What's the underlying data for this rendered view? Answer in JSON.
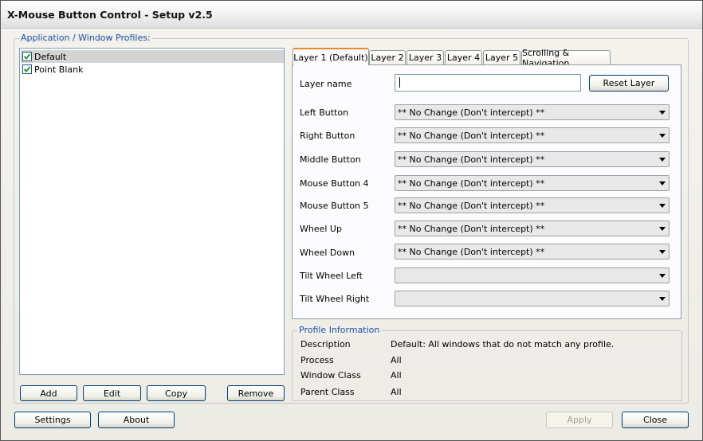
{
  "window": {
    "title": "X-Mouse Button Control - Setup v2.5"
  },
  "profiles": {
    "legend": "Application / Window Profiles:",
    "items": [
      {
        "label": "Default",
        "checked": true,
        "selected": true
      },
      {
        "label": "Point Blank",
        "checked": true,
        "selected": false
      }
    ],
    "buttons": {
      "add": "Add",
      "edit": "Edit",
      "copy": "Copy",
      "remove": "Remove"
    }
  },
  "tabs": [
    "Layer 1 (Default)",
    "Layer 2",
    "Layer 3",
    "Layer 4",
    "Layer 5",
    "Scrolling & Navigation"
  ],
  "layer": {
    "name_label": "Layer name",
    "name_value": "",
    "reset_button": "Reset Layer",
    "mappings": [
      {
        "label": "Left Button",
        "value": "** No Change (Don't intercept) **"
      },
      {
        "label": "Right Button",
        "value": "** No Change (Don't intercept) **"
      },
      {
        "label": "Middle Button",
        "value": "** No Change (Don't intercept) **"
      },
      {
        "label": "Mouse Button 4",
        "value": "** No Change (Don't intercept) **"
      },
      {
        "label": "Mouse Button 5",
        "value": "** No Change (Don't intercept) **"
      },
      {
        "label": "Wheel Up",
        "value": "** No Change (Don't intercept) **"
      },
      {
        "label": "Wheel Down",
        "value": "** No Change (Don't intercept) **"
      },
      {
        "label": "Tilt Wheel Left",
        "value": ""
      },
      {
        "label": "Tilt Wheel Right",
        "value": ""
      }
    ]
  },
  "profile_info": {
    "legend": "Profile Information",
    "rows": [
      {
        "label": "Description",
        "value": "Default: All windows that do not match any profile."
      },
      {
        "label": "Process",
        "value": "All"
      },
      {
        "label": "Window Class",
        "value": "All"
      },
      {
        "label": "Parent Class",
        "value": "All"
      }
    ]
  },
  "footer": {
    "settings": "Settings",
    "about": "About",
    "apply": "Apply",
    "close": "Close"
  },
  "colors": {
    "accent": "#1c4fa6",
    "tab_highlight": "#e68b2c",
    "check": "#21a121"
  }
}
